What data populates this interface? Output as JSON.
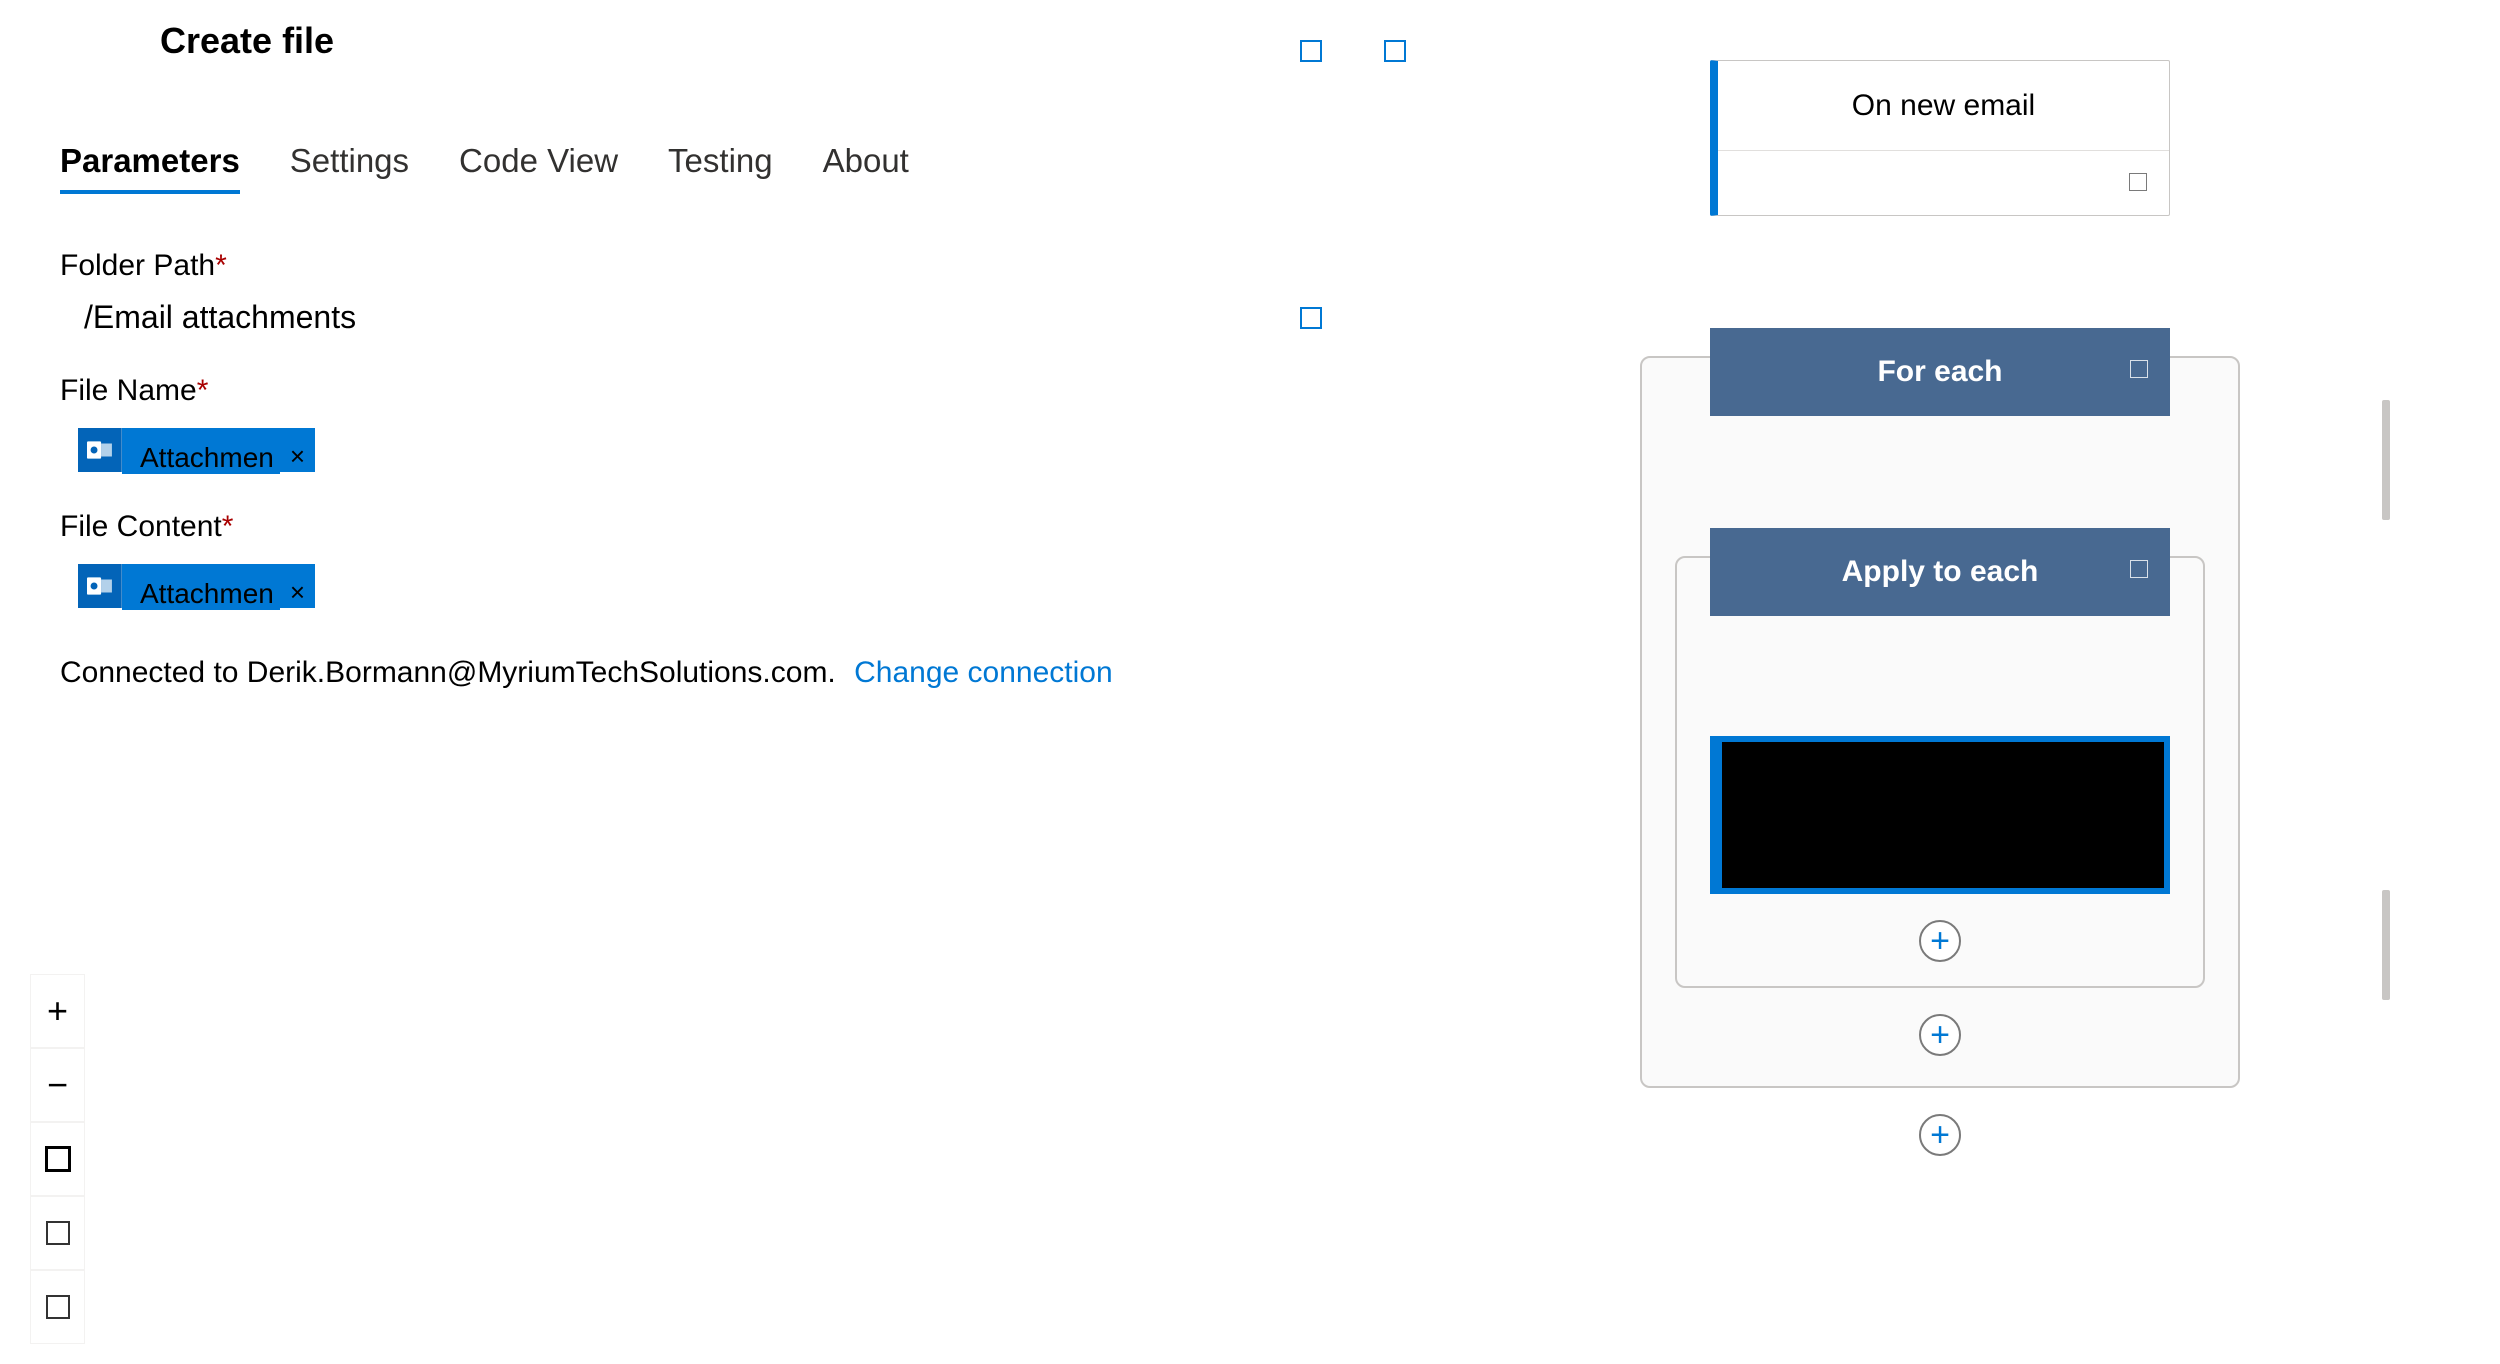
{
  "panel": {
    "title": "Create file",
    "tabs": [
      "Parameters",
      "Settings",
      "Code View",
      "Testing",
      "About"
    ],
    "activeTab": 0
  },
  "fields": {
    "folderPath": {
      "label": "Folder Path",
      "value": "/Email attachments"
    },
    "fileName": {
      "label": "File Name",
      "token": "Attachmen"
    },
    "fileContent": {
      "label": "File Content",
      "token": "Attachmen"
    }
  },
  "connection": {
    "prefix": "Connected to ",
    "account": "Derik.Bormann@MyriumTechSolutions.com.",
    "changeLabel": "Change connection"
  },
  "flow": {
    "trigger": "On new email",
    "forEach": "For each",
    "applyToEach": "Apply to each"
  },
  "zoom": {
    "plus": "+",
    "minus": "−"
  }
}
